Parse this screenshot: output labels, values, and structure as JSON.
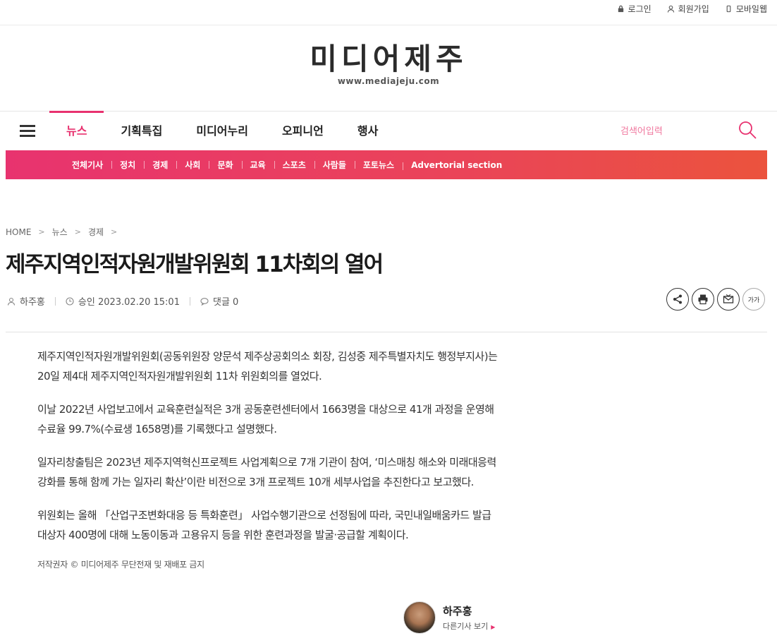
{
  "utility": {
    "login": "로그인",
    "signup": "회원가입",
    "mobile": "모바일웹"
  },
  "logo": {
    "name": "미디어제주",
    "url": "www.mediajeju.com"
  },
  "gnb": {
    "items": [
      "뉴스",
      "기획특집",
      "미디어누리",
      "오피니언",
      "행사"
    ],
    "search_placeholder": "검색어입력"
  },
  "subnav": {
    "items": [
      "전체기사",
      "정치",
      "경제",
      "사회",
      "문화",
      "교육",
      "스포츠",
      "사람들",
      "포토뉴스",
      "Advertorial section"
    ]
  },
  "breadcrumb": [
    "HOME",
    "뉴스",
    "경제"
  ],
  "article": {
    "title": "제주지역인적자원개발위원회 11차회의 열어",
    "author": "하주홍",
    "published": "승인 2023.02.20 15:01",
    "comments": "댓글 0",
    "font_button": "가가",
    "paragraphs": [
      "제주지역인적자원개발위원회(공동위원장 양문석 제주상공회의소 회장, 김성중 제주특별자치도 행정부지사)는 20일 제4대 제주지역인적자원개발위원회 11차 위원회의를 열었다.",
      "이날 2022년 사업보고에서 교육훈련실적은 3개 공동훈련센터에서 1663명을 대상으로 41개 과정을 운영해 수료율 99.7%(수료생 1658명)를 기록했다고 설명했다.",
      "일자리창출팀은 2023년 제주지역혁신프로젝트 사업계획으로 7개 기관이 참여, ‘미스매칭 해소와 미래대응력 강화를 통해 함께 가는 일자리 확산’이란 비전으로 3개 프로젝트 10개 세부사업을 추진한다고 보고했다.",
      "위원회는 올해 「산업구조변화대응 등 특화훈련」 사업수행기관으로 선정됨에 따라, 국민내일배움카드 발급 대상자 400명에 대해 노동이동과 고용유지 등을 위한 훈련과정을 발굴·공급할 계획이다."
    ],
    "copyright": "저작권자 © 미디어제주 무단전재 및 재배포 금지"
  },
  "author_box": {
    "name": "하주홍",
    "more": "다른기사 보기"
  },
  "colors": {
    "accent": "#e8316f",
    "subnav_start": "#e8336f",
    "subnav_end": "#eb533d"
  }
}
